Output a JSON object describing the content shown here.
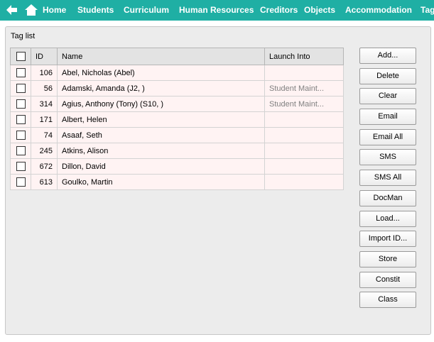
{
  "nav": {
    "items": [
      "Home",
      "Students",
      "Curriculum",
      "Human Resources",
      "Creditors",
      "Objects",
      "Accommodation",
      "Tag"
    ],
    "accent_color": "#1fafa4"
  },
  "panel": {
    "title": "Tag list"
  },
  "table": {
    "headers": {
      "id": "ID",
      "name": "Name",
      "launch": "Launch Into"
    },
    "rows": [
      {
        "id": "106",
        "name": "Abel, Nicholas (Abel)",
        "launch": ""
      },
      {
        "id": "56",
        "name": "Adamski, Amanda (J2, )",
        "launch": "Student Maint..."
      },
      {
        "id": "314",
        "name": "Agius, Anthony (Tony) (S10, )",
        "launch": "Student Maint..."
      },
      {
        "id": "171",
        "name": "Albert, Helen",
        "launch": ""
      },
      {
        "id": "74",
        "name": "Asaaf, Seth",
        "launch": ""
      },
      {
        "id": "245",
        "name": "Atkins, Alison",
        "launch": ""
      },
      {
        "id": "672",
        "name": "Dillon, David",
        "launch": ""
      },
      {
        "id": "613",
        "name": "Goulko, Martin",
        "launch": ""
      }
    ]
  },
  "buttons": [
    "Add...",
    "Delete",
    "Clear",
    "Email",
    "Email All",
    "SMS",
    "SMS All",
    "DocMan",
    "Load...",
    "Import ID...",
    "Store",
    "Constit",
    "Class"
  ]
}
